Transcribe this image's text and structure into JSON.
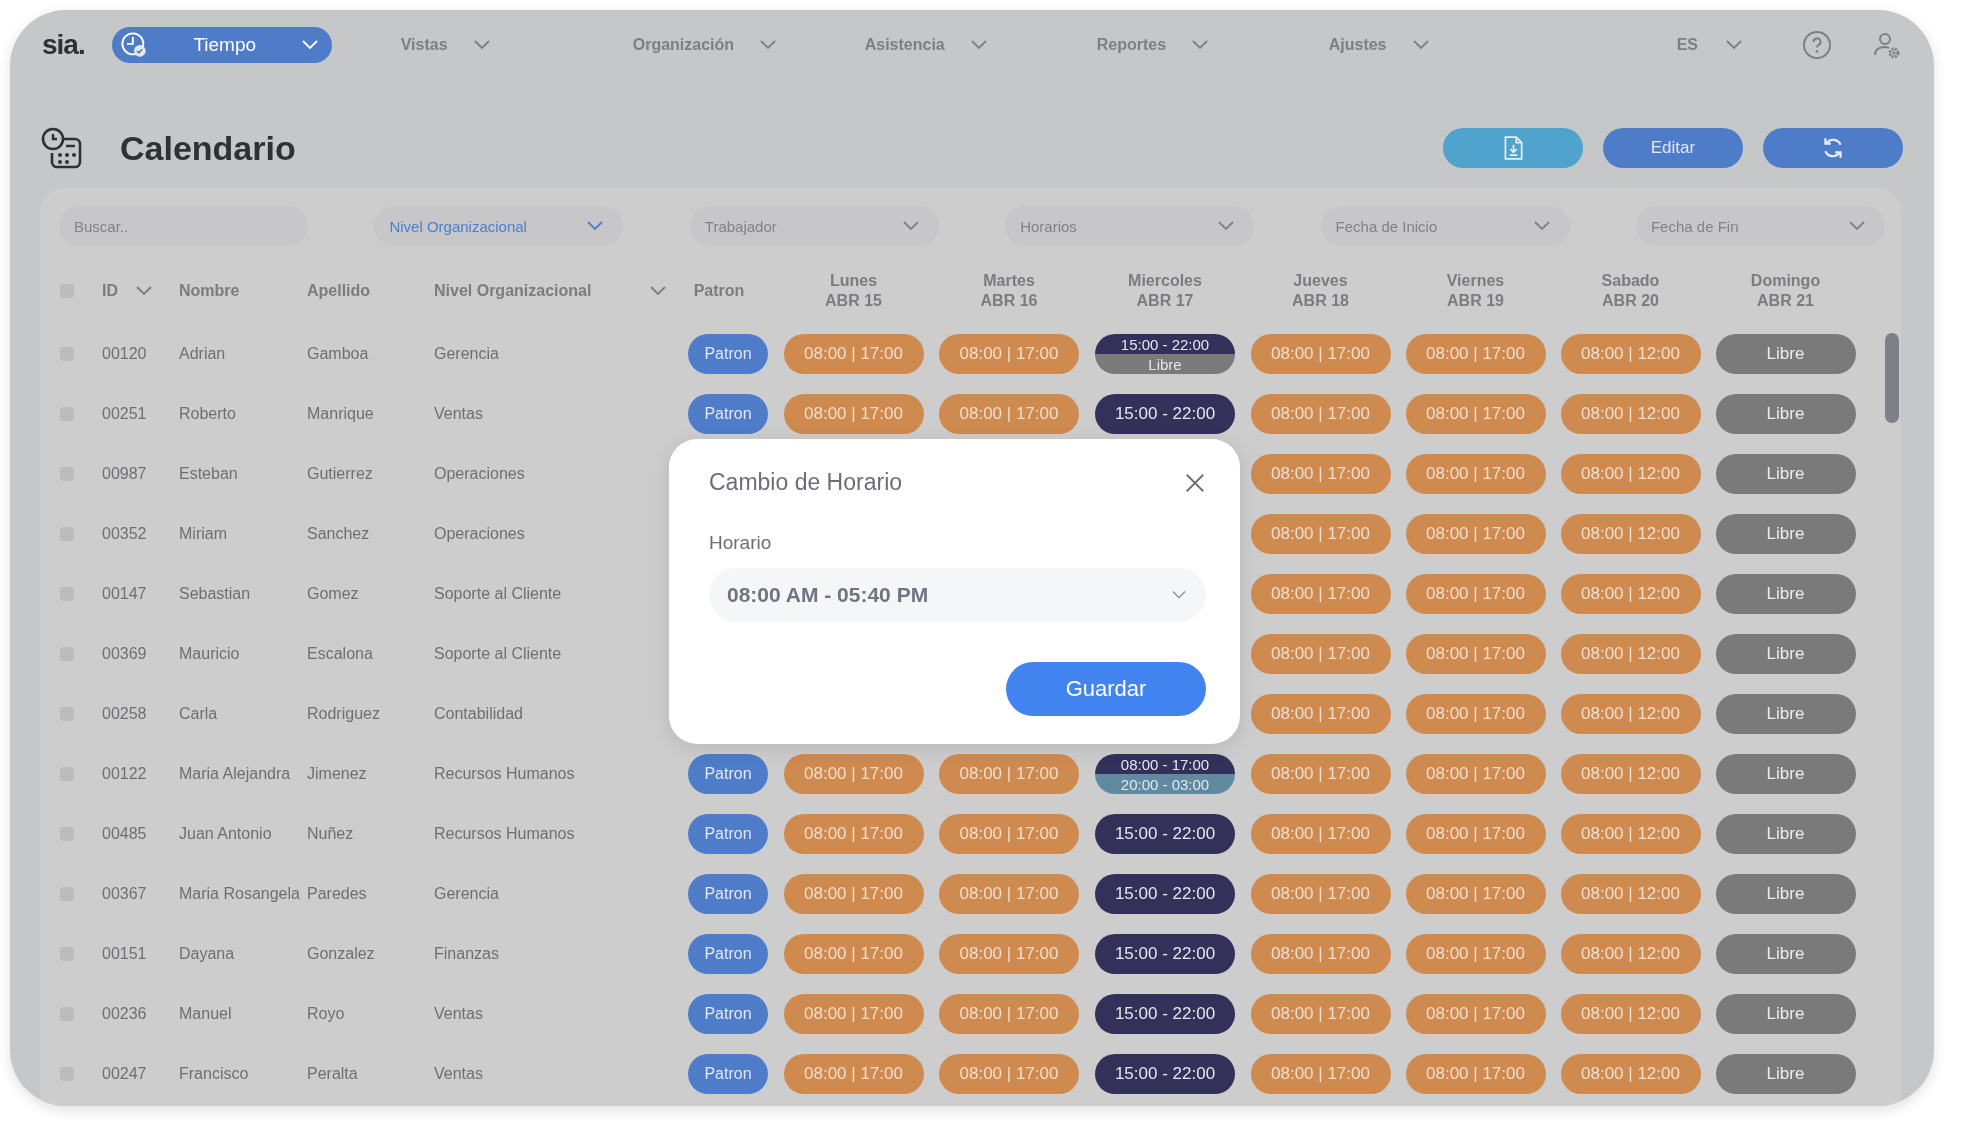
{
  "logo": "sia.",
  "nav": {
    "items": [
      {
        "label": "Tiempo",
        "selected": true
      },
      {
        "label": "Vistas",
        "selected": false
      },
      {
        "label": "Organización",
        "selected": false
      },
      {
        "label": "Asistencia",
        "selected": false
      },
      {
        "label": "Reportes",
        "selected": false
      },
      {
        "label": "Ajustes",
        "selected": false
      }
    ],
    "language": "ES"
  },
  "page": {
    "title": "Calendario",
    "buttons": [
      {
        "kind": "export"
      },
      {
        "kind": "text",
        "label": "Editar"
      },
      {
        "kind": "refresh"
      }
    ]
  },
  "filters": [
    {
      "kind": "search",
      "placeholder": "Buscar.."
    },
    {
      "kind": "dropdown",
      "label": "Nivel Organizacional",
      "active": true
    },
    {
      "kind": "dropdown",
      "label": "Trabajador",
      "active": false
    },
    {
      "kind": "dropdown",
      "label": "Horarios",
      "active": false
    },
    {
      "kind": "dropdown",
      "label": "Fecha de Inicio",
      "active": false
    },
    {
      "kind": "dropdown",
      "label": "Fecha de Fin",
      "active": false
    }
  ],
  "table": {
    "select_all": {
      "checked": false
    },
    "columns": [
      {
        "label": "ID",
        "kind": "dropdown"
      },
      {
        "label": "Nombre",
        "kind": "plain"
      },
      {
        "label": "Apellido",
        "kind": "plain"
      },
      {
        "label": "Nivel Organizacional",
        "kind": "dropdown"
      },
      {
        "label": "Patron",
        "kind": "plain"
      }
    ],
    "day_columns": [
      {
        "day": "Lunes",
        "date": "ABR 15"
      },
      {
        "day": "Martes",
        "date": "ABR 16"
      },
      {
        "day": "Miercoles",
        "date": "ABR 17"
      },
      {
        "day": "Jueves",
        "date": "ABR 18"
      },
      {
        "day": "Viernes",
        "date": "ABR 19"
      },
      {
        "day": "Sabado",
        "date": "ABR 20"
      },
      {
        "day": "Domingo",
        "date": "ABR 21"
      }
    ],
    "rows": [
      {
        "checked": false,
        "id": "00120",
        "name": "Adrian",
        "surname": "Gamboa",
        "level": "Gerencia",
        "pattern": "Patron",
        "days": [
          {
            "kind": "work",
            "text": "08:00 | 17:00"
          },
          {
            "kind": "work",
            "text": "08:00 | 17:00"
          },
          {
            "kind": "split",
            "parts": [
              {
                "kind": "night",
                "text": "15:00 - 22:00"
              },
              {
                "kind": "free",
                "text": "Libre"
              }
            ]
          },
          {
            "kind": "work",
            "text": "08:00 | 17:00"
          },
          {
            "kind": "work",
            "text": "08:00 | 17:00"
          },
          {
            "kind": "work",
            "text": "08:00 | 12:00"
          },
          {
            "kind": "free",
            "text": "Libre"
          }
        ]
      },
      {
        "checked": false,
        "id": "00251",
        "name": "Roberto",
        "surname": "Manrique",
        "level": "Ventas",
        "pattern": "Patron",
        "days": [
          {
            "kind": "work",
            "text": "08:00 | 17:00"
          },
          {
            "kind": "work",
            "text": "08:00 | 17:00"
          },
          {
            "kind": "night",
            "text": "15:00 - 22:00"
          },
          {
            "kind": "work",
            "text": "08:00 | 17:00"
          },
          {
            "kind": "work",
            "text": "08:00 | 17:00"
          },
          {
            "kind": "work",
            "text": "08:00 | 12:00"
          },
          {
            "kind": "free",
            "text": "Libre"
          }
        ]
      },
      {
        "checked": false,
        "id": "00987",
        "name": "Esteban",
        "surname": "Gutierrez",
        "level": "Operaciones",
        "days": [
          {
            "kind": "hidden"
          },
          {
            "kind": "hidden"
          },
          {
            "kind": "hidden"
          },
          {
            "kind": "work",
            "text": "08:00 | 17:00"
          },
          {
            "kind": "work",
            "text": "08:00 | 17:00"
          },
          {
            "kind": "work",
            "text": "08:00 | 12:00"
          },
          {
            "kind": "free",
            "text": "Libre"
          }
        ]
      },
      {
        "checked": false,
        "id": "00352",
        "name": "Miriam",
        "surname": "Sanchez",
        "level": "Operaciones",
        "days": [
          {
            "kind": "hidden"
          },
          {
            "kind": "hidden"
          },
          {
            "kind": "hidden"
          },
          {
            "kind": "work",
            "text": "08:00 | 17:00"
          },
          {
            "kind": "work",
            "text": "08:00 | 17:00"
          },
          {
            "kind": "work",
            "text": "08:00 | 12:00"
          },
          {
            "kind": "free",
            "text": "Libre"
          }
        ]
      },
      {
        "checked": false,
        "id": "00147",
        "name": "Sebastian",
        "surname": "Gomez",
        "level": "Soporte al Cliente",
        "days": [
          {
            "kind": "hidden"
          },
          {
            "kind": "hidden"
          },
          {
            "kind": "hidden"
          },
          {
            "kind": "work",
            "text": "08:00 | 17:00"
          },
          {
            "kind": "work",
            "text": "08:00 | 17:00"
          },
          {
            "kind": "work",
            "text": "08:00 | 12:00"
          },
          {
            "kind": "free",
            "text": "Libre"
          }
        ]
      },
      {
        "checked": false,
        "id": "00369",
        "name": "Mauricio",
        "surname": "Escalona",
        "level": "Soporte al Cliente",
        "days": [
          {
            "kind": "hidden"
          },
          {
            "kind": "hidden"
          },
          {
            "kind": "hidden"
          },
          {
            "kind": "work",
            "text": "08:00 | 17:00"
          },
          {
            "kind": "work",
            "text": "08:00 | 17:00"
          },
          {
            "kind": "work",
            "text": "08:00 | 12:00"
          },
          {
            "kind": "free",
            "text": "Libre"
          }
        ]
      },
      {
        "checked": false,
        "id": "00258",
        "name": "Carla",
        "surname": "Rodriguez",
        "level": "Contabilidad",
        "days": [
          {
            "kind": "hidden"
          },
          {
            "kind": "hidden"
          },
          {
            "kind": "hidden"
          },
          {
            "kind": "work",
            "text": "08:00 | 17:00"
          },
          {
            "kind": "work",
            "text": "08:00 | 17:00"
          },
          {
            "kind": "work",
            "text": "08:00 | 12:00"
          },
          {
            "kind": "free",
            "text": "Libre"
          }
        ]
      },
      {
        "checked": false,
        "id": "00122",
        "name": "Maria Alejandra",
        "surname": "Jimenez",
        "level": "Recursos Humanos",
        "pattern": "Patron",
        "days": [
          {
            "kind": "work",
            "text": "08:00 | 17:00"
          },
          {
            "kind": "work",
            "text": "08:00 | 17:00"
          },
          {
            "kind": "split",
            "parts": [
              {
                "kind": "night",
                "text": "08:00 - 17:00"
              },
              {
                "kind": "late",
                "text": "20:00 - 03:00"
              }
            ]
          },
          {
            "kind": "work",
            "text": "08:00 | 17:00"
          },
          {
            "kind": "work",
            "text": "08:00 | 17:00"
          },
          {
            "kind": "work",
            "text": "08:00 | 12:00"
          },
          {
            "kind": "free",
            "text": "Libre"
          }
        ]
      },
      {
        "checked": false,
        "id": "00485",
        "name": "Juan Antonio",
        "surname": "Nuñez",
        "level": "Recursos Humanos",
        "pattern": "Patron",
        "days": [
          {
            "kind": "work",
            "text": "08:00 | 17:00"
          },
          {
            "kind": "work",
            "text": "08:00 | 17:00"
          },
          {
            "kind": "night",
            "text": "15:00 - 22:00"
          },
          {
            "kind": "work",
            "text": "08:00 | 17:00"
          },
          {
            "kind": "work",
            "text": "08:00 | 17:00"
          },
          {
            "kind": "work",
            "text": "08:00 | 12:00"
          },
          {
            "kind": "free",
            "text": "Libre"
          }
        ]
      },
      {
        "checked": false,
        "id": "00367",
        "name": "Maria Rosangela",
        "surname": "Paredes",
        "level": "Gerencia",
        "pattern": "Patron",
        "days": [
          {
            "kind": "work",
            "text": "08:00 | 17:00"
          },
          {
            "kind": "work",
            "text": "08:00 | 17:00"
          },
          {
            "kind": "night",
            "text": "15:00 - 22:00"
          },
          {
            "kind": "work",
            "text": "08:00 | 17:00"
          },
          {
            "kind": "work",
            "text": "08:00 | 17:00"
          },
          {
            "kind": "work",
            "text": "08:00 | 12:00"
          },
          {
            "kind": "free",
            "text": "Libre"
          }
        ]
      },
      {
        "checked": false,
        "id": "00151",
        "name": "Dayana",
        "surname": "Gonzalez",
        "level": "Finanzas",
        "pattern": "Patron",
        "days": [
          {
            "kind": "work",
            "text": "08:00 | 17:00"
          },
          {
            "kind": "work",
            "text": "08:00 | 17:00"
          },
          {
            "kind": "night",
            "text": "15:00 - 22:00"
          },
          {
            "kind": "work",
            "text": "08:00 | 17:00"
          },
          {
            "kind": "work",
            "text": "08:00 | 17:00"
          },
          {
            "kind": "work",
            "text": "08:00 | 12:00"
          },
          {
            "kind": "free",
            "text": "Libre"
          }
        ]
      },
      {
        "checked": false,
        "id": "00236",
        "name": "Manuel",
        "surname": "Royo",
        "level": "Ventas",
        "pattern": "Patron",
        "days": [
          {
            "kind": "work",
            "text": "08:00 | 17:00"
          },
          {
            "kind": "work",
            "text": "08:00 | 17:00"
          },
          {
            "kind": "night",
            "text": "15:00 - 22:00"
          },
          {
            "kind": "work",
            "text": "08:00 | 17:00"
          },
          {
            "kind": "work",
            "text": "08:00 | 17:00"
          },
          {
            "kind": "work",
            "text": "08:00 | 12:00"
          },
          {
            "kind": "free",
            "text": "Libre"
          }
        ]
      },
      {
        "checked": false,
        "id": "00247",
        "name": "Francisco",
        "surname": "Peralta",
        "level": "Ventas",
        "pattern": "Patron",
        "days": [
          {
            "kind": "work",
            "text": "08:00 | 17:00"
          },
          {
            "kind": "work",
            "text": "08:00 | 17:00"
          },
          {
            "kind": "night",
            "text": "15:00 - 22:00"
          },
          {
            "kind": "work",
            "text": "08:00 | 17:00"
          },
          {
            "kind": "work",
            "text": "08:00 | 17:00"
          },
          {
            "kind": "work",
            "text": "08:00 | 12:00"
          },
          {
            "kind": "free",
            "text": "Libre"
          }
        ]
      }
    ]
  },
  "dialog": {
    "title": "Cambio de Horario",
    "field_label": "Horario",
    "value": "08:00 AM - 05:40 PM",
    "button": "Guardar"
  }
}
